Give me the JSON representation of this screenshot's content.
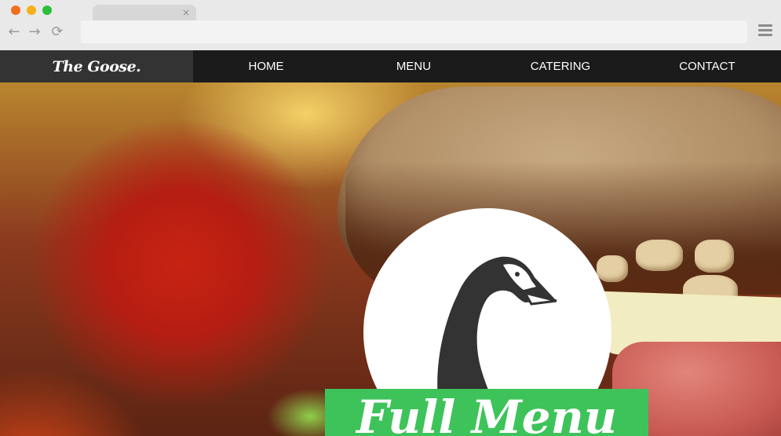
{
  "browser": {
    "tab": {
      "close_glyph": "×"
    },
    "nav": {
      "back_glyph": "←",
      "forward_glyph": "→",
      "reload_glyph": "⟳"
    },
    "url": "",
    "icons": [
      "back-icon",
      "forward-icon",
      "reload-icon",
      "menu-icon",
      "close-icon"
    ],
    "traffic_colors": {
      "close": "#f26d1f",
      "minimize": "#f5b21a",
      "zoom": "#2bbf3a"
    }
  },
  "site": {
    "logo": "The Goose.",
    "nav": {
      "home": "HOME",
      "menu": "MENU",
      "catering": "CATERING",
      "contact": "CONTACT"
    },
    "hero": {
      "banner_text": "Full Menu",
      "banner_color": "#3ec35a",
      "icon": "goose-icon"
    },
    "colors": {
      "nav_bg": "#1b1b1b",
      "logo_bg": "#333333"
    }
  }
}
